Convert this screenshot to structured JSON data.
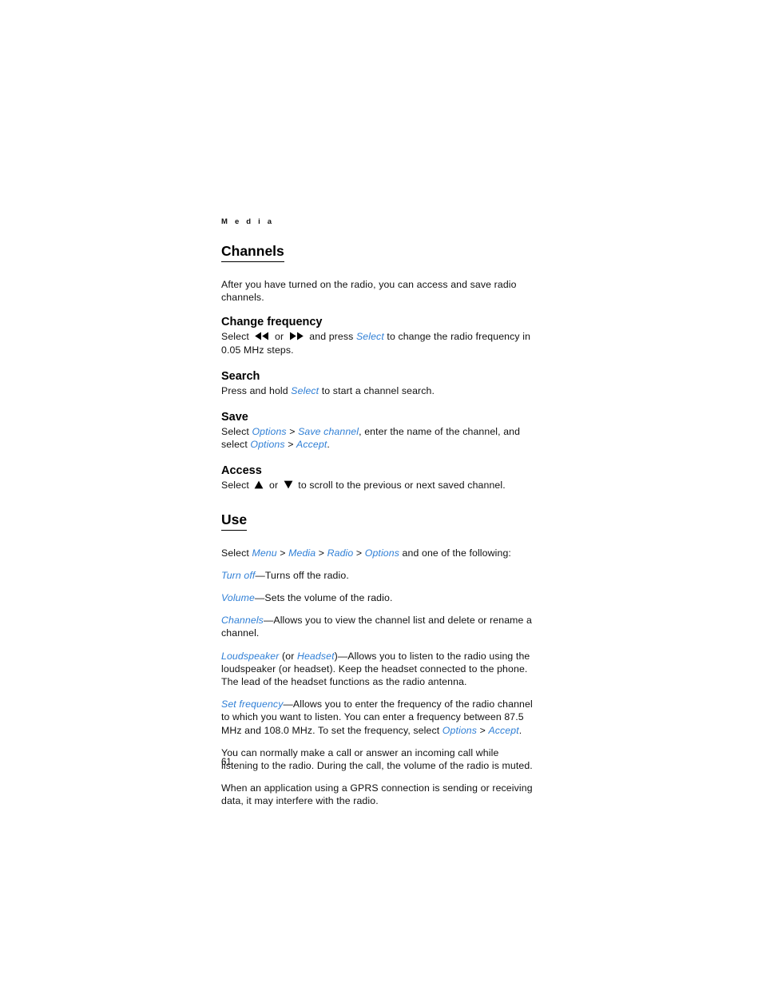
{
  "page": {
    "running_header": "M e d i a",
    "page_number": "61",
    "link_color": "#2f7fd6",
    "text_color": "#101010"
  },
  "sections": {
    "channels": {
      "title": "Channels",
      "intro": "After you have turned on the radio, you can access and save radio channels.",
      "change_frequency": {
        "title": "Change frequency",
        "t1": "Select ",
        "icon_rewind": "rewind-icon",
        "t2": " or ",
        "icon_forward": "fast-forward-icon",
        "t3": " and press ",
        "link_select": "Select",
        "t4": " to change the radio frequency in 0.05 MHz steps."
      },
      "search": {
        "title": "Search",
        "t1": "Press and hold ",
        "link_select": "Select",
        "t2": " to start a channel search."
      },
      "save": {
        "title": "Save",
        "t1": "Select ",
        "link_options_1": "Options",
        "sep1": " > ",
        "link_save_channel": "Save channel",
        "t2": ", enter the name of the channel, and select ",
        "link_options_2": "Options",
        "sep2": " > ",
        "link_accept": "Accept",
        "t3": "."
      },
      "access": {
        "title": "Access",
        "t1": "Select ",
        "icon_up": "scroll-up-icon",
        "t2": " or ",
        "icon_down": "scroll-down-icon",
        "t3": " to scroll to the previous or next saved channel."
      }
    },
    "use": {
      "title": "Use",
      "path": {
        "t1": "Select ",
        "link_menu": "Menu",
        "sep1": " > ",
        "link_media": "Media",
        "sep2": " > ",
        "link_radio": "Radio",
        "sep3": " > ",
        "link_options": "Options",
        "t2": " and one of the following:"
      },
      "items": [
        {
          "link": "Turn off",
          "desc": "—Turns off the radio."
        },
        {
          "link": "Volume",
          "desc": "—Sets the volume of the radio."
        },
        {
          "link": "Channels",
          "desc": "—Allows you to view the channel list and delete or rename a channel."
        }
      ],
      "loudspeaker": {
        "link_loudspeaker": "Loudspeaker",
        "t1": " (or ",
        "link_headset": "Headset",
        "t2": ")—Allows you to listen to the radio using the loudspeaker (or headset). Keep the headset connected to the phone. The lead of the headset functions as the radio antenna."
      },
      "set_frequency": {
        "link_set_frequency": "Set frequency",
        "t1": "—Allows you to enter the frequency of the radio channel to which you want to listen. You can enter a frequency between 87.5 MHz and 108.0 MHz. To set the frequency, select ",
        "link_options": "Options",
        "sep1": " > ",
        "link_accept": "Accept",
        "t2": "."
      },
      "note_call": "You can normally make a call or answer an incoming call while listening to the radio. During the call, the volume of the radio is muted.",
      "note_gprs": "When an application using a GPRS connection is sending or receiving data, it may interfere with the radio."
    }
  }
}
